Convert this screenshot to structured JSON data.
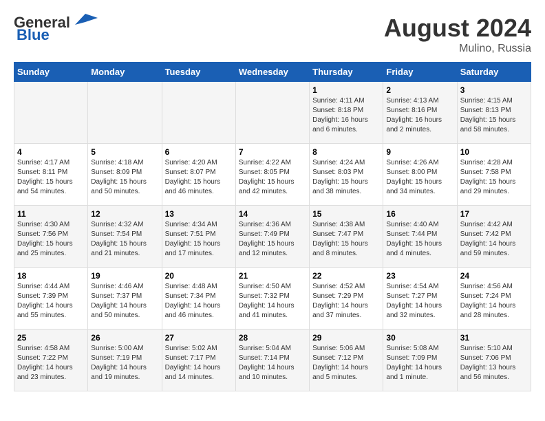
{
  "logo": {
    "line1": "General",
    "line2": "Blue"
  },
  "title": "August 2024",
  "subtitle": "Mulino, Russia",
  "weekdays": [
    "Sunday",
    "Monday",
    "Tuesday",
    "Wednesday",
    "Thursday",
    "Friday",
    "Saturday"
  ],
  "weeks": [
    [
      {
        "day": "",
        "info": ""
      },
      {
        "day": "",
        "info": ""
      },
      {
        "day": "",
        "info": ""
      },
      {
        "day": "",
        "info": ""
      },
      {
        "day": "1",
        "info": "Sunrise: 4:11 AM\nSunset: 8:18 PM\nDaylight: 16 hours\nand 6 minutes."
      },
      {
        "day": "2",
        "info": "Sunrise: 4:13 AM\nSunset: 8:16 PM\nDaylight: 16 hours\nand 2 minutes."
      },
      {
        "day": "3",
        "info": "Sunrise: 4:15 AM\nSunset: 8:13 PM\nDaylight: 15 hours\nand 58 minutes."
      }
    ],
    [
      {
        "day": "4",
        "info": "Sunrise: 4:17 AM\nSunset: 8:11 PM\nDaylight: 15 hours\nand 54 minutes."
      },
      {
        "day": "5",
        "info": "Sunrise: 4:18 AM\nSunset: 8:09 PM\nDaylight: 15 hours\nand 50 minutes."
      },
      {
        "day": "6",
        "info": "Sunrise: 4:20 AM\nSunset: 8:07 PM\nDaylight: 15 hours\nand 46 minutes."
      },
      {
        "day": "7",
        "info": "Sunrise: 4:22 AM\nSunset: 8:05 PM\nDaylight: 15 hours\nand 42 minutes."
      },
      {
        "day": "8",
        "info": "Sunrise: 4:24 AM\nSunset: 8:03 PM\nDaylight: 15 hours\nand 38 minutes."
      },
      {
        "day": "9",
        "info": "Sunrise: 4:26 AM\nSunset: 8:00 PM\nDaylight: 15 hours\nand 34 minutes."
      },
      {
        "day": "10",
        "info": "Sunrise: 4:28 AM\nSunset: 7:58 PM\nDaylight: 15 hours\nand 29 minutes."
      }
    ],
    [
      {
        "day": "11",
        "info": "Sunrise: 4:30 AM\nSunset: 7:56 PM\nDaylight: 15 hours\nand 25 minutes."
      },
      {
        "day": "12",
        "info": "Sunrise: 4:32 AM\nSunset: 7:54 PM\nDaylight: 15 hours\nand 21 minutes."
      },
      {
        "day": "13",
        "info": "Sunrise: 4:34 AM\nSunset: 7:51 PM\nDaylight: 15 hours\nand 17 minutes."
      },
      {
        "day": "14",
        "info": "Sunrise: 4:36 AM\nSunset: 7:49 PM\nDaylight: 15 hours\nand 12 minutes."
      },
      {
        "day": "15",
        "info": "Sunrise: 4:38 AM\nSunset: 7:47 PM\nDaylight: 15 hours\nand 8 minutes."
      },
      {
        "day": "16",
        "info": "Sunrise: 4:40 AM\nSunset: 7:44 PM\nDaylight: 15 hours\nand 4 minutes."
      },
      {
        "day": "17",
        "info": "Sunrise: 4:42 AM\nSunset: 7:42 PM\nDaylight: 14 hours\nand 59 minutes."
      }
    ],
    [
      {
        "day": "18",
        "info": "Sunrise: 4:44 AM\nSunset: 7:39 PM\nDaylight: 14 hours\nand 55 minutes."
      },
      {
        "day": "19",
        "info": "Sunrise: 4:46 AM\nSunset: 7:37 PM\nDaylight: 14 hours\nand 50 minutes."
      },
      {
        "day": "20",
        "info": "Sunrise: 4:48 AM\nSunset: 7:34 PM\nDaylight: 14 hours\nand 46 minutes."
      },
      {
        "day": "21",
        "info": "Sunrise: 4:50 AM\nSunset: 7:32 PM\nDaylight: 14 hours\nand 41 minutes."
      },
      {
        "day": "22",
        "info": "Sunrise: 4:52 AM\nSunset: 7:29 PM\nDaylight: 14 hours\nand 37 minutes."
      },
      {
        "day": "23",
        "info": "Sunrise: 4:54 AM\nSunset: 7:27 PM\nDaylight: 14 hours\nand 32 minutes."
      },
      {
        "day": "24",
        "info": "Sunrise: 4:56 AM\nSunset: 7:24 PM\nDaylight: 14 hours\nand 28 minutes."
      }
    ],
    [
      {
        "day": "25",
        "info": "Sunrise: 4:58 AM\nSunset: 7:22 PM\nDaylight: 14 hours\nand 23 minutes."
      },
      {
        "day": "26",
        "info": "Sunrise: 5:00 AM\nSunset: 7:19 PM\nDaylight: 14 hours\nand 19 minutes."
      },
      {
        "day": "27",
        "info": "Sunrise: 5:02 AM\nSunset: 7:17 PM\nDaylight: 14 hours\nand 14 minutes."
      },
      {
        "day": "28",
        "info": "Sunrise: 5:04 AM\nSunset: 7:14 PM\nDaylight: 14 hours\nand 10 minutes."
      },
      {
        "day": "29",
        "info": "Sunrise: 5:06 AM\nSunset: 7:12 PM\nDaylight: 14 hours\nand 5 minutes."
      },
      {
        "day": "30",
        "info": "Sunrise: 5:08 AM\nSunset: 7:09 PM\nDaylight: 14 hours\nand 1 minute."
      },
      {
        "day": "31",
        "info": "Sunrise: 5:10 AM\nSunset: 7:06 PM\nDaylight: 13 hours\nand 56 minutes."
      }
    ]
  ]
}
